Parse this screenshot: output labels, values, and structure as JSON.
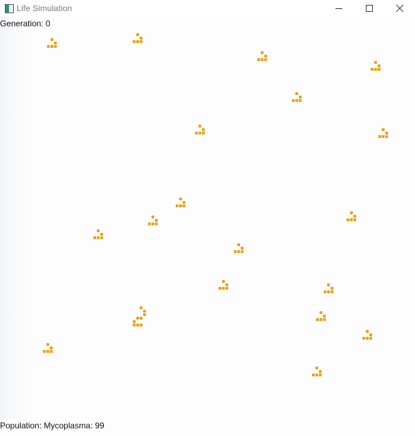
{
  "window": {
    "title": "Life Simulation",
    "icon": "app-window-icon"
  },
  "controls": {
    "minimize": "minimize-icon",
    "maximize": "maximize-icon",
    "close": "close-icon"
  },
  "status": {
    "generation": "Generation: 0",
    "population": "Population: Mycoplasma: 99"
  },
  "colors": {
    "cell": "#f0a010"
  }
}
